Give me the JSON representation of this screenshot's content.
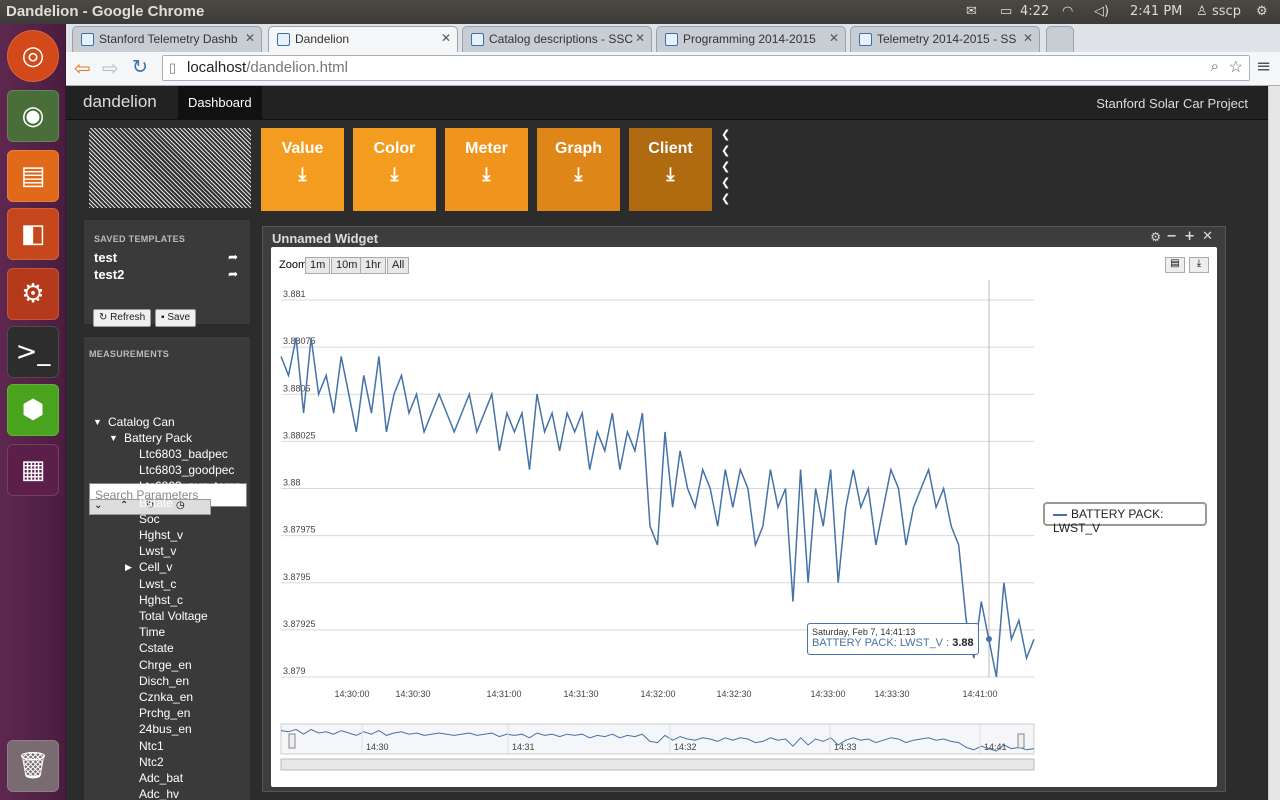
{
  "os": {
    "window_title": "Dandelion - Google Chrome",
    "battery": "4:22",
    "clock": "2:41 PM",
    "user": "sscp"
  },
  "tabs": [
    {
      "label": "Stanford Telemetry Dashb"
    },
    {
      "label": "Dandelion"
    },
    {
      "label": "Catalog descriptions - SSC"
    },
    {
      "label": "Programming 2014-2015"
    },
    {
      "label": "Telemetry 2014-2015 - SS"
    }
  ],
  "address": {
    "host": "localhost",
    "path": "/dandelion.html"
  },
  "navbar": {
    "brand": "dandelion",
    "dashboard": "Dashboard",
    "project": "Stanford Solar Car Project"
  },
  "widget_buttons": [
    "Value",
    "Color",
    "Meter",
    "Graph",
    "Client"
  ],
  "widget_colors": [
    "#f39c1f",
    "#f39c1f",
    "#f39c1f",
    "#e0891a",
    "#b36b10"
  ],
  "templates": {
    "header": "SAVED TEMPLATES",
    "items": [
      "test",
      "test2"
    ],
    "refresh": "Refresh",
    "save": "Save"
  },
  "measurements": {
    "header": "MEASUREMENTS",
    "search_placeholder": "Search Parameters"
  },
  "tree": {
    "root": "Catalog Can",
    "group": "Battery Pack",
    "items": [
      "Ltc6803_badpec",
      "Ltc6803_goodpec",
      "Ltc6803_avg_temp",
      "Bstate",
      "Soc",
      "Hghst_v",
      "Lwst_v",
      "Cell_v",
      "Lwst_c",
      "Hghst_c",
      "Total Voltage",
      "Time",
      "Cstate",
      "Chrge_en",
      "Disch_en",
      "Cznka_en",
      "Prchg_en",
      "24bus_en",
      "Ntc1",
      "Ntc2",
      "Adc_bat",
      "Adc_hv"
    ]
  },
  "widget": {
    "title": "Unnamed Widget"
  },
  "zoom": {
    "label": "Zoom",
    "options": [
      "1m",
      "10m",
      "1hr",
      "All"
    ]
  },
  "chart_data": {
    "type": "line",
    "series": [
      {
        "name": "BATTERY PACK: LWST_V",
        "color": "#4572a7"
      }
    ],
    "y_ticks": [
      "3.881",
      "3.88075",
      "3.8805",
      "3.88025",
      "3.88",
      "3.87975",
      "3.8795",
      "3.87925",
      "3.879"
    ],
    "ylim": [
      3.879,
      3.881
    ],
    "x_ticks": [
      "14:30:00",
      "14:30:30",
      "14:31:00",
      "14:31:30",
      "14:32:00",
      "14:32:30",
      "14:33:00",
      "14:33:30",
      "14:41:00"
    ],
    "navigator_ticks": [
      "14:30",
      "14:31",
      "14:32",
      "14:33",
      "14:41"
    ],
    "values": [
      3.8807,
      3.8806,
      3.8808,
      3.8804,
      3.8808,
      3.8805,
      3.8806,
      3.8804,
      3.8807,
      3.8805,
      3.8803,
      3.8806,
      3.8804,
      3.8807,
      3.8803,
      3.8805,
      3.8806,
      3.8804,
      3.8805,
      3.8803,
      3.8804,
      3.8805,
      3.8804,
      3.8803,
      3.8804,
      3.8805,
      3.8803,
      3.8804,
      3.8805,
      3.8802,
      3.8804,
      3.8803,
      3.8804,
      3.8801,
      3.8805,
      3.8803,
      3.8804,
      3.8802,
      3.8804,
      3.8803,
      3.8804,
      3.8801,
      3.8803,
      3.8802,
      3.8804,
      3.8801,
      3.8803,
      3.8802,
      3.8804,
      3.8798,
      3.8797,
      3.8803,
      3.8799,
      3.8802,
      3.88,
      3.8799,
      3.8801,
      3.88,
      3.8798,
      3.8801,
      3.8799,
      3.8801,
      3.88,
      3.8797,
      3.8798,
      3.8801,
      3.8799,
      3.88,
      3.8794,
      3.8801,
      3.8795,
      3.88,
      3.8798,
      3.8801,
      3.8795,
      3.8799,
      3.8801,
      3.8799,
      3.88,
      3.8797,
      3.8799,
      3.8801,
      3.88,
      3.8797,
      3.8799,
      3.88,
      3.8801,
      3.8799,
      3.88,
      3.8798,
      3.8797,
      3.8793,
      3.8791,
      3.8794,
      3.8792,
      3.879,
      3.8795,
      3.8792,
      3.8793,
      3.8791,
      3.8792
    ],
    "tooltip": {
      "date": "Saturday, Feb 7, 14:41:13",
      "series": "BATTERY PACK: LWST_V",
      "value": "3.88"
    }
  }
}
